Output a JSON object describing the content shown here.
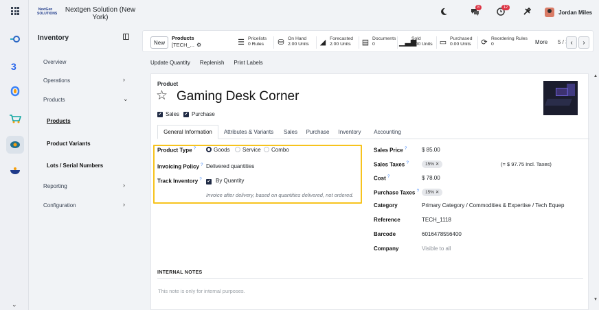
{
  "topbar": {
    "company_logo_text": "NextGen SOLUTIONS",
    "company_name": "Nextgen Solution (New York)",
    "messages_count": "8",
    "activities_count": "12",
    "user_name": "Jordan Miles"
  },
  "sidebar": {
    "title": "Inventory",
    "items": [
      {
        "label": "Overview"
      },
      {
        "label": "Operations"
      },
      {
        "label": "Products"
      },
      {
        "label": "Products"
      },
      {
        "label": "Product Variants"
      },
      {
        "label": "Lots / Serial Numbers"
      },
      {
        "label": "Reporting"
      },
      {
        "label": "Configuration"
      }
    ]
  },
  "control": {
    "new_label": "New",
    "breadcrumb_parent": "Products",
    "breadcrumb_current": "[TECH_...",
    "stats": [
      {
        "label": "Pricelists",
        "value": "0 Rules",
        "icon": "list-icon"
      },
      {
        "label": "On Hand",
        "value": "2.00 Units",
        "icon": "cubes-icon"
      },
      {
        "label": "Forecasted",
        "value": "2.00 Units",
        "icon": "chart-area-icon"
      },
      {
        "label": "Documents",
        "value": "0",
        "icon": "file-icon"
      },
      {
        "label": "Sold",
        "value": "0.00 Units",
        "icon": "bar-chart-icon"
      },
      {
        "label": "Purchased",
        "value": "0.00 Units",
        "icon": "credit-card-icon"
      },
      {
        "label": "Reordering Rules",
        "value": "0",
        "icon": "refresh-icon"
      }
    ],
    "more_label": "More",
    "pager": "5 / 35"
  },
  "actions": {
    "update_quantity": "Update Quantity",
    "replenish": "Replenish",
    "print_labels": "Print Labels"
  },
  "product": {
    "type_label": "Product",
    "name": "Gaming Desk Corner",
    "sales_label": "Sales",
    "purchase_label": "Purchase"
  },
  "tabs": [
    {
      "label": "General Information"
    },
    {
      "label": "Attributes & Variants"
    },
    {
      "label": "Sales"
    },
    {
      "label": "Purchase"
    },
    {
      "label": "Inventory"
    },
    {
      "label": "Accounting"
    }
  ],
  "left_fields": {
    "product_type_label": "Product Type",
    "product_type_options": [
      "Goods",
      "Service",
      "Combo"
    ],
    "product_type_selected": "Goods",
    "invoicing_policy_label": "Invoicing Policy",
    "invoicing_policy_value": "Delivered quantities",
    "track_inventory_label": "Track Inventory",
    "track_inventory_value": "By Quantity",
    "hint": "Invoice after delivery, based on quantities delivered, not ordered."
  },
  "right_fields": {
    "sales_price_label": "Sales Price",
    "sales_price_value": "$ 85.00",
    "sales_taxes_label": "Sales Taxes",
    "sales_taxes_tag": "15%",
    "sales_taxes_note": "(= $ 97.75 Incl. Taxes)",
    "cost_label": "Cost",
    "cost_value": "$ 78.00",
    "purchase_taxes_label": "Purchase Taxes",
    "purchase_taxes_tag": "15%",
    "category_label": "Category",
    "category_value": "Primary Category / Commodities & Expertise / Tech Equep",
    "reference_label": "Reference",
    "reference_value": "TECH_1118",
    "barcode_label": "Barcode",
    "barcode_value": "6016478556400",
    "company_label": "Company",
    "company_placeholder": "Visible to all"
  },
  "notes": {
    "heading": "INTERNAL NOTES",
    "placeholder": "This note is only for internal purposes."
  },
  "colors": {
    "highlight": "#f7c31d",
    "accent": "#1f2a44",
    "badge": "#dc3545"
  }
}
